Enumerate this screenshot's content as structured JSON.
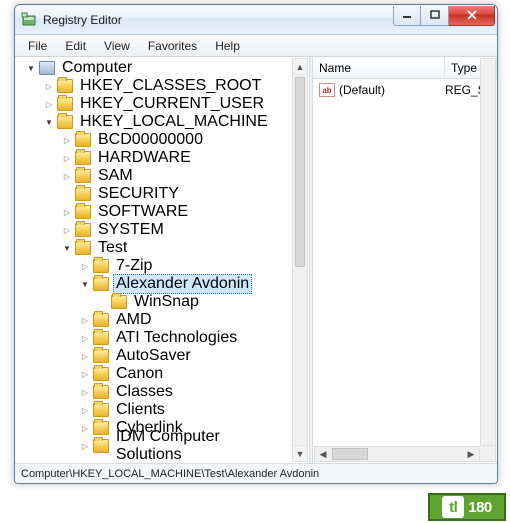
{
  "window": {
    "title": "Registry Editor"
  },
  "menu": {
    "file": "File",
    "edit": "Edit",
    "view": "View",
    "favorites": "Favorites",
    "help": "Help"
  },
  "tree": {
    "root": "Computer",
    "hives": {
      "hkcr": "HKEY_CLASSES_ROOT",
      "hkcu": "HKEY_CURRENT_USER",
      "hklm": "HKEY_LOCAL_MACHINE",
      "bcd": "BCD00000000",
      "hardware": "HARDWARE",
      "sam": "SAM",
      "security": "SECURITY",
      "software": "SOFTWARE",
      "system": "SYSTEM",
      "test": "Test",
      "sevenzip": "7-Zip",
      "selected": "Alexander Avdonin",
      "winsnap": "WinSnap",
      "amd": "AMD",
      "ati": "ATI Technologies",
      "autosaver": "AutoSaver",
      "canon": "Canon",
      "classes": "Classes",
      "clients": "Clients",
      "cyberlink": "Cyberlink",
      "idm": "IDM Computer Solutions"
    }
  },
  "list": {
    "headers": {
      "name": "Name",
      "type": "Type"
    },
    "rows": [
      {
        "icon": "ab",
        "name": "(Default)",
        "type": "REG_SZ"
      }
    ]
  },
  "statusbar": {
    "path": "Computer\\HKEY_LOCAL_MACHINE\\Test\\Alexander Avdonin"
  },
  "watermark": {
    "badge": "tl",
    "text": "180"
  }
}
